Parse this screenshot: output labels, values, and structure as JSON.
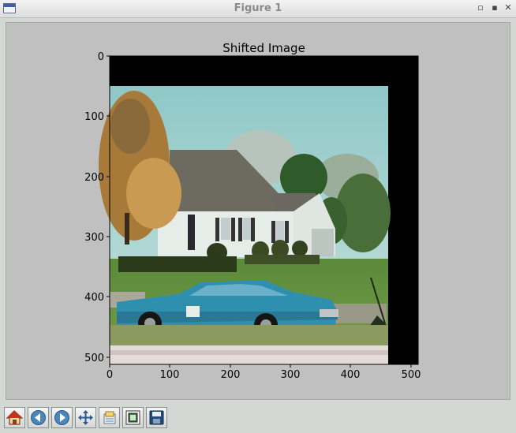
{
  "window": {
    "title": "Figure 1"
  },
  "figure": {
    "title": "Shifted Image",
    "x_ticks": [
      "0",
      "100",
      "200",
      "300",
      "400",
      "500"
    ],
    "y_ticks": [
      "0",
      "100",
      "200",
      "300",
      "400",
      "500"
    ]
  },
  "toolbar": {
    "buttons": [
      "home-icon",
      "back-arrow-icon",
      "forward-arrow-icon",
      "pan-move-icon",
      "zoom-rect-icon",
      "subplots-config-icon",
      "save-disk-icon"
    ]
  }
}
